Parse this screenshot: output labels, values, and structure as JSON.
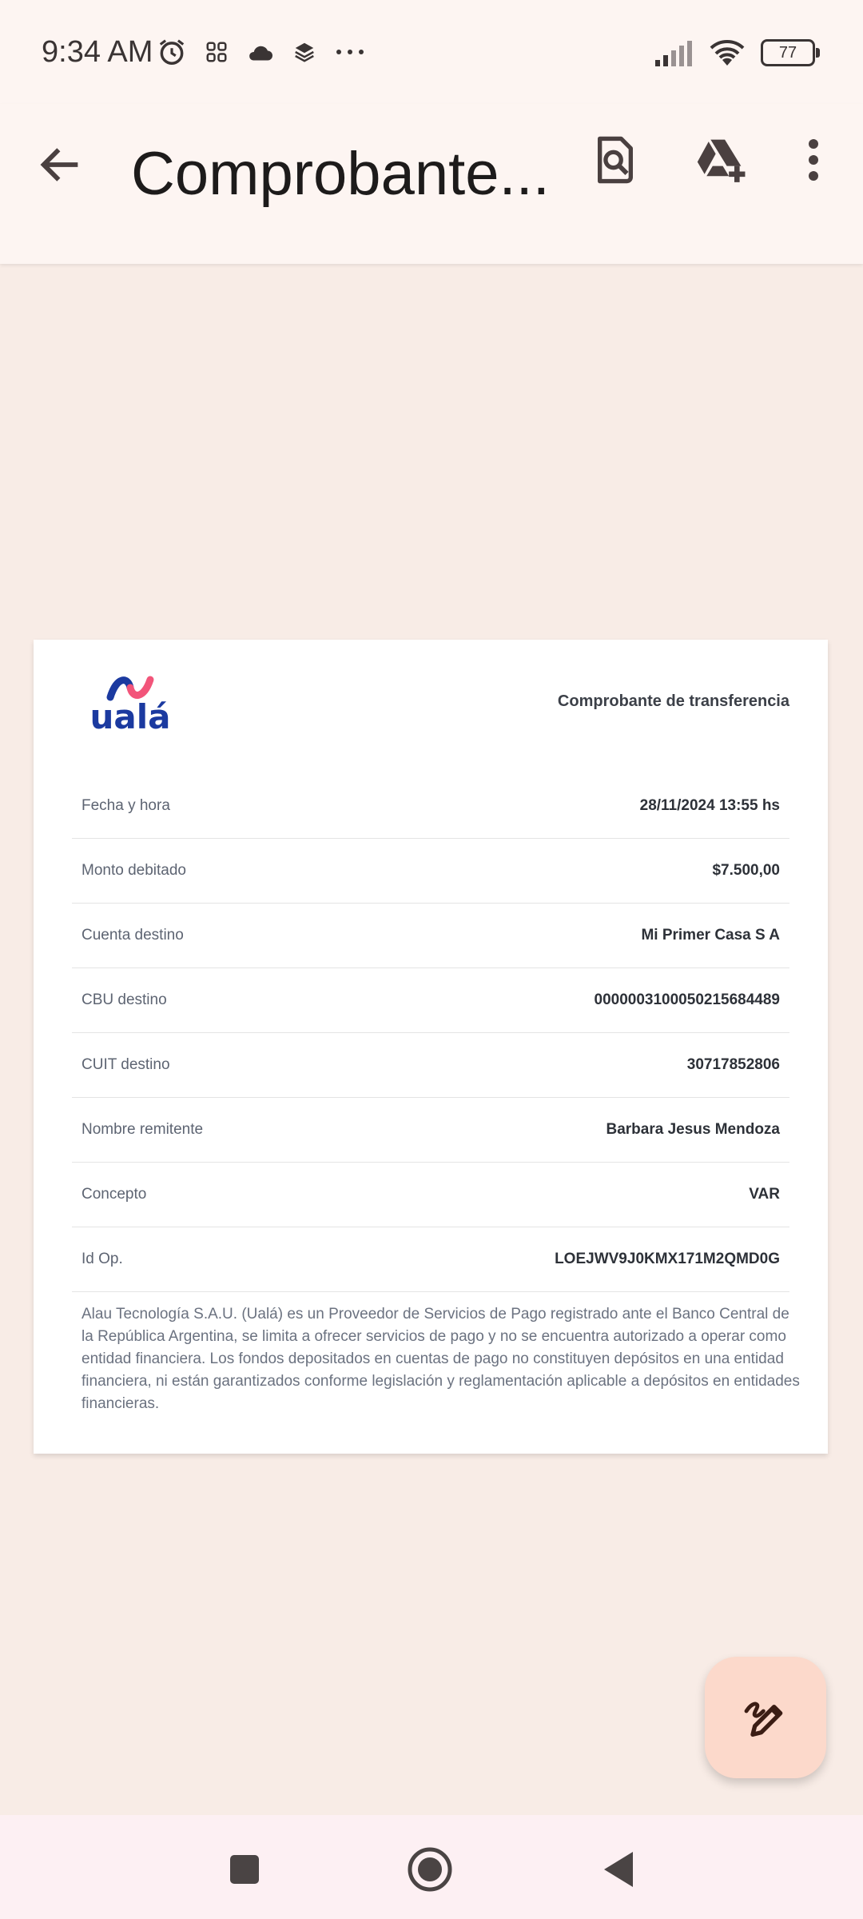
{
  "status_bar": {
    "time": "9:34 AM",
    "icons": [
      "alarm-icon",
      "apps-icon",
      "cloud-icon",
      "layers-icon",
      "more-dots-icon"
    ],
    "battery": "77"
  },
  "app_bar": {
    "title": "Comprobante..."
  },
  "document": {
    "logo_text": "ualá",
    "doc_title": "Comprobante de transferencia",
    "rows": [
      {
        "label": "Fecha y hora",
        "value": "28/11/2024 13:55 hs"
      },
      {
        "label": "Monto debitado",
        "value": "$7.500,00"
      },
      {
        "label": "Cuenta destino",
        "value": "Mi Primer Casa S A"
      },
      {
        "label": "CBU destino",
        "value": "0000003100050215684489"
      },
      {
        "label": "CUIT destino",
        "value": "30717852806"
      },
      {
        "label": "Nombre remitente",
        "value": "Barbara Jesus Mendoza"
      },
      {
        "label": "Concepto",
        "value": "VAR"
      },
      {
        "label": "Id Op.",
        "value": "LOEJWV9J0KMX171M2QMD0G"
      }
    ],
    "legal": "Alau Tecnología S.A.U. (Ualá) es un Proveedor de Servicios de Pago registrado ante el Banco Central de la República Argentina, se limita a ofrecer servicios de pago y no se encuentra autorizado a operar como entidad financiera. Los fondos depositados en cuentas de pago no constituyen depósitos en una entidad financiera, ni están garantizados conforme legislación y reglamentación aplicable a depósitos en entidades financieras."
  },
  "colors": {
    "brand_blue": "#1b3aa0",
    "brand_pink": "#f2557a",
    "fab_bg": "#fcd9cb"
  }
}
